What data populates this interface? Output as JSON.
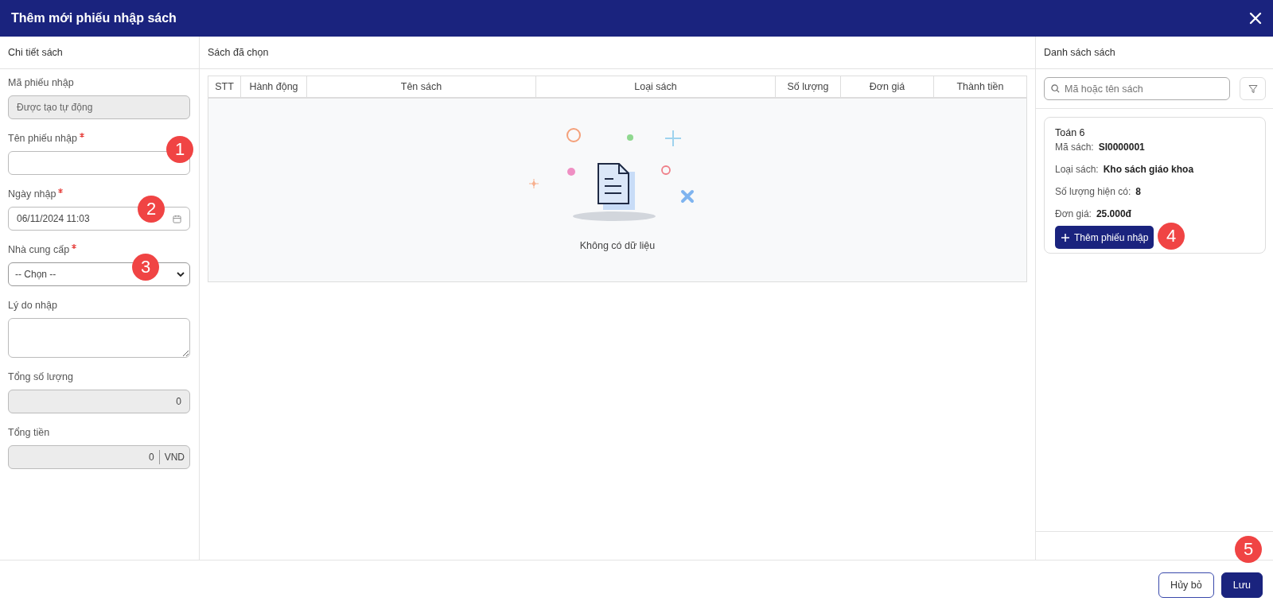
{
  "window": {
    "title": "Thêm mới phiếu nhập sách"
  },
  "details_panel": {
    "title": "Chi tiết sách",
    "fields": [
      {
        "kind": "readonly",
        "label": "Mã phiếu nhập",
        "required": false,
        "placeholder": "Được tạo tự động"
      },
      {
        "kind": "text",
        "label": "Tên phiếu nhập",
        "required": true
      },
      {
        "kind": "date",
        "label": "Ngày nhập",
        "required": true,
        "value": "06/11/2024 11:03"
      },
      {
        "kind": "select",
        "label": "Nhà cung cấp",
        "required": true,
        "value": "-- Chọn --"
      },
      {
        "kind": "textarea",
        "label": "Lý do nhập",
        "required": false
      },
      {
        "kind": "number",
        "label": "Tổng số lượng",
        "required": false,
        "value": "0"
      },
      {
        "kind": "currency",
        "label": "Tổng tiền",
        "required": false,
        "value": "0",
        "unit": "VND"
      }
    ]
  },
  "selected_panel": {
    "title": "Sách đã chọn",
    "table": {
      "columns": [
        "STT",
        "Hành động",
        "Tên sách",
        "Loại sách",
        "Số lượng",
        "Đơn giá",
        "Thành tiền"
      ],
      "empty_text": "Không có dữ liệu"
    }
  },
  "book_list": {
    "title": "Danh sách sách",
    "search": {
      "placeholder": "Mã hoặc tên sách"
    },
    "books": [
      {
        "name": "Toán 6",
        "fields": [
          {
            "label": "Mã sách:",
            "value": "SI0000001"
          },
          {
            "label": "Loại sách:",
            "value": "Kho sách giáo khoa"
          },
          {
            "label": "Số lượng hiện có:",
            "value": "8"
          },
          {
            "label": "Đơn giá:",
            "value": "25.000đ"
          }
        ],
        "button": "Thêm phiếu nhập"
      }
    ]
  },
  "footer": {
    "buttons": [
      {
        "kind": "outline",
        "label": "Hủy bỏ"
      },
      {
        "kind": "primary",
        "label": "Lưu"
      }
    ]
  },
  "annotations": [
    "1",
    "2",
    "3",
    "4",
    "5"
  ]
}
